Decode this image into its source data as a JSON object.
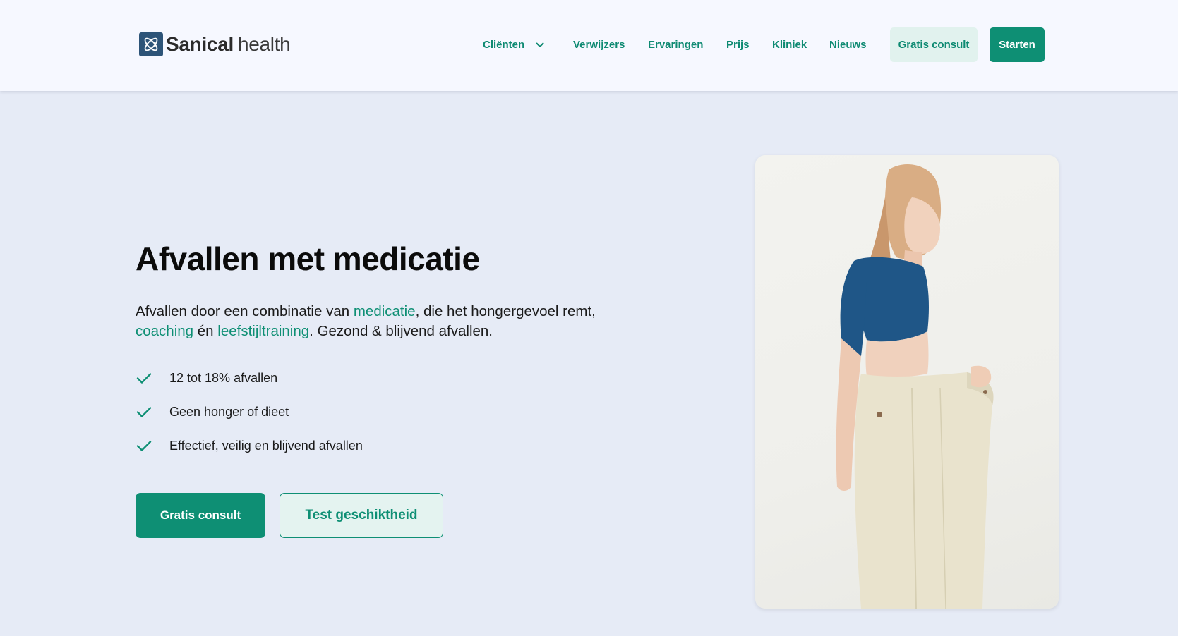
{
  "brand": {
    "name_bold": "Sanical",
    "name_regular": "health",
    "logo_color": "#2d5478"
  },
  "nav": {
    "items": [
      {
        "label": "Cliënten",
        "has_dropdown": true
      },
      {
        "label": "Verwijzers"
      },
      {
        "label": "Ervaringen"
      },
      {
        "label": "Prijs"
      },
      {
        "label": "Kliniek"
      },
      {
        "label": "Nieuws"
      }
    ],
    "consult_button": "Gratis consult",
    "start_button": "Starten"
  },
  "hero": {
    "title": "Afvallen met medicatie",
    "description": {
      "part1": "Afvallen door een combinatie van ",
      "link1": "medicatie",
      "part2": ", die het hongergevoel remt, ",
      "link2": "coaching",
      "part3": " én ",
      "link3": "leefstijltraining",
      "part4": ". Gezond & blijvend afvallen."
    },
    "checklist": [
      "12 tot 18% afvallen",
      "Geen honger of dieet",
      "Effectief, veilig en blijvend afvallen"
    ],
    "primary_cta": "Gratis consult",
    "secondary_cta": "Test geschiktheid"
  },
  "colors": {
    "accent": "#0e8f74",
    "accent_light": "#e1f2ee",
    "page_bg": "#e6ebf6",
    "header_bg": "#f6f8ff"
  },
  "icons": [
    "atom-logo-icon",
    "chevron-down-icon",
    "check-icon"
  ]
}
